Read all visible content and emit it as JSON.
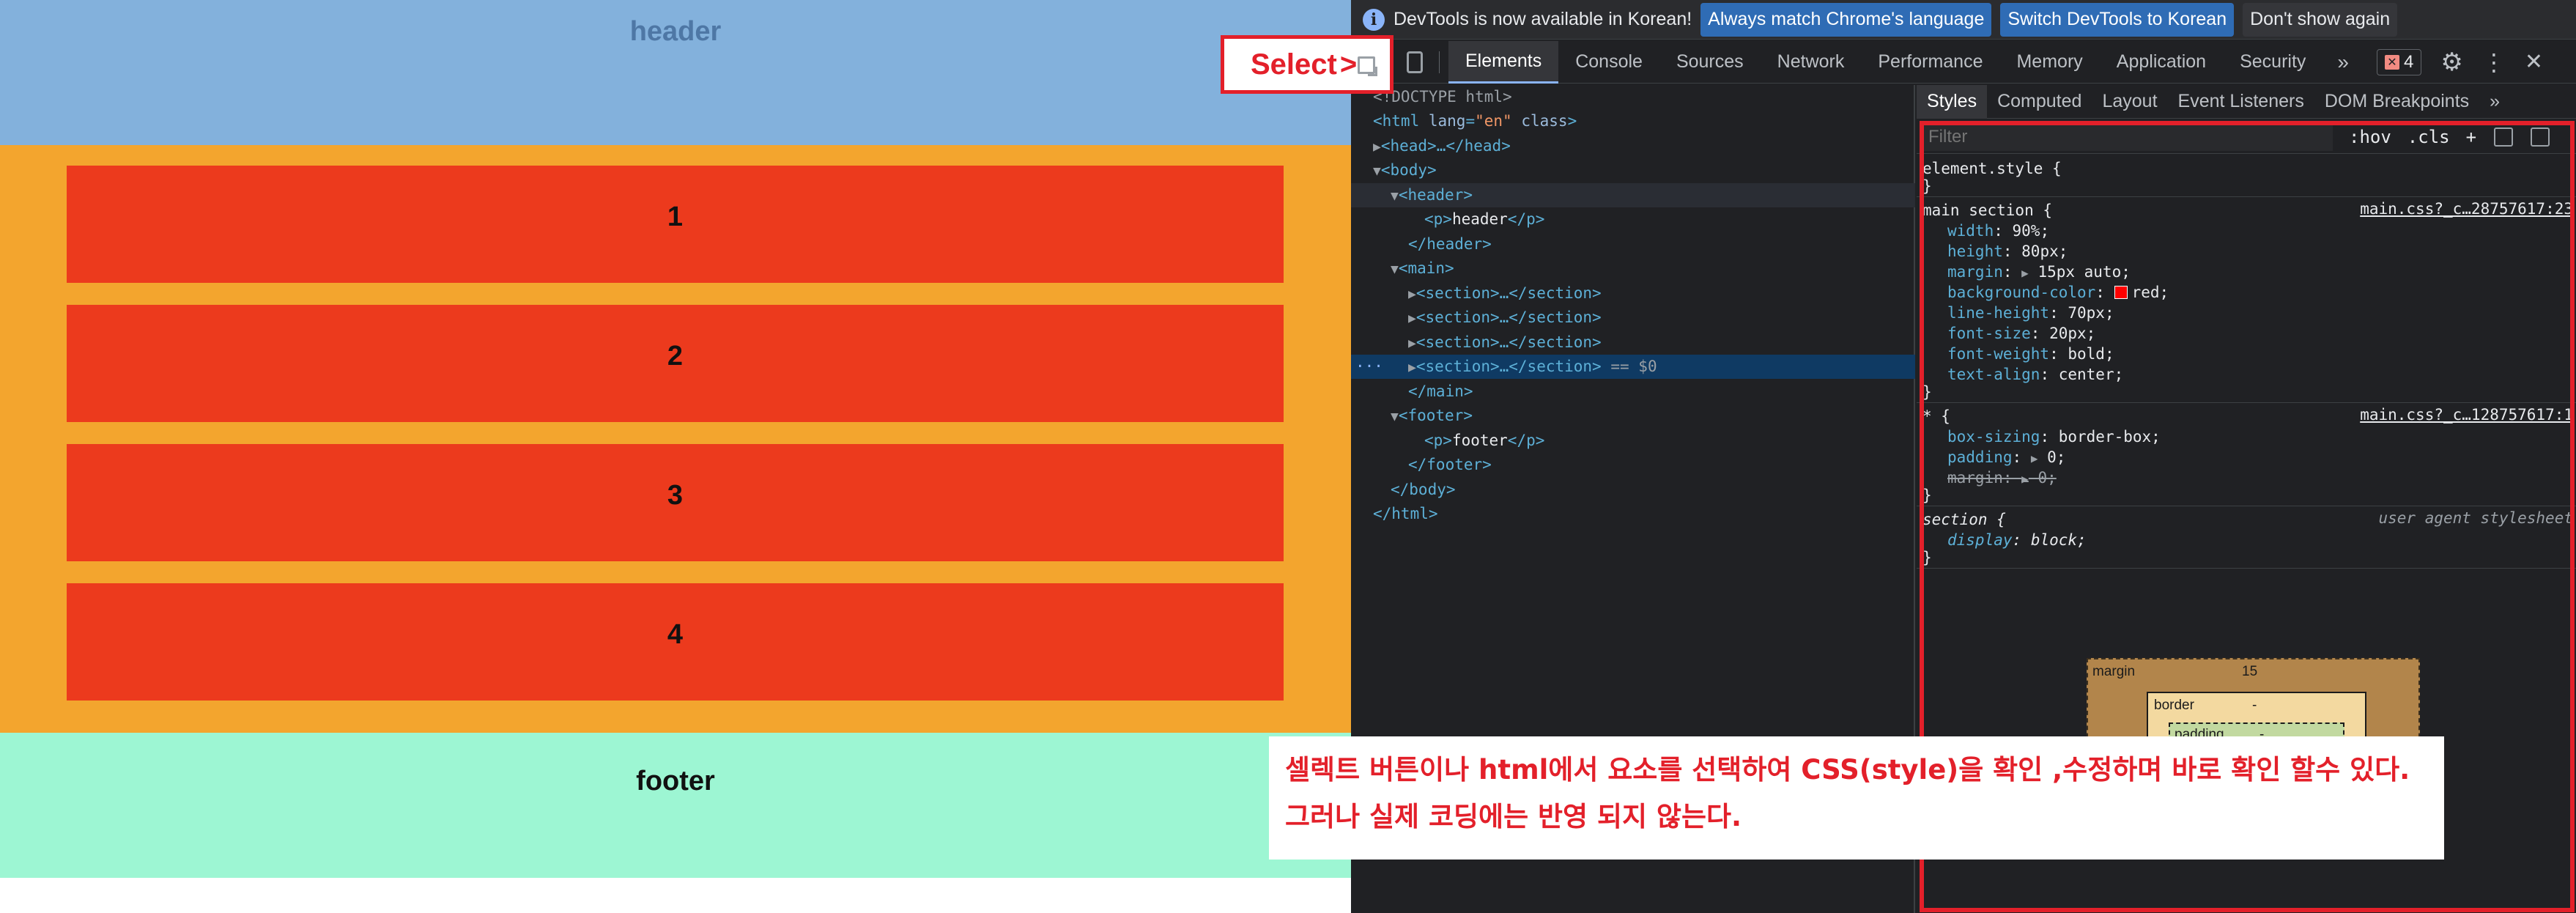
{
  "preview": {
    "header_text": "header",
    "sections": [
      "1",
      "2",
      "3",
      "4"
    ],
    "footer_text": "footer",
    "colors": {
      "header": "#83b1dc",
      "main": "#f3a52e",
      "section": "#ec3a1d",
      "footer": "#9df6d3"
    }
  },
  "callout": {
    "label": "Select",
    "arrow": ">"
  },
  "infobar": {
    "message": "DevTools is now available in Korean!",
    "btn_match": "Always match Chrome's language",
    "btn_switch": "Switch DevTools to Korean",
    "btn_dismiss": "Don't show again"
  },
  "tabs": [
    "Elements",
    "Console",
    "Sources",
    "Network",
    "Performance",
    "Memory",
    "Application",
    "Security"
  ],
  "tabs_more": "»",
  "error_count": "4",
  "dom": {
    "doctype": "<!DOCTYPE html>",
    "html_open_tag": "<html",
    "html_attr_lang": "lang",
    "html_attr_lang_val": "\"en\"",
    "html_attr_class": "class",
    "head": "<head>…</head>",
    "body_open": "<body>",
    "header_open": "<header>",
    "p_header_open": "<p>",
    "p_header_text": "header",
    "p_header_close": "</p>",
    "header_close": "</header>",
    "main_open": "<main>",
    "section_collapsed": "<section>…</section>",
    "selected_suffix": "== $0",
    "main_close": "</main>",
    "footer_open": "<footer>",
    "p_footer_open": "<p>",
    "p_footer_text": "footer",
    "p_footer_close": "</p>",
    "footer_close": "</footer>",
    "body_close": "</body>",
    "html_close": "</html>",
    "dots": "···"
  },
  "styles": {
    "subtabs": [
      "Styles",
      "Computed",
      "Layout",
      "Event Listeners",
      "DOM Breakpoints"
    ],
    "subtabs_more": "»",
    "filter_placeholder": "Filter",
    "hov": ":hov",
    "cls": ".cls",
    "plus": "+",
    "rules": {
      "element_style": "element.style {",
      "main_section": {
        "selector": "main section {",
        "source": "main.css?_c…28757617:23",
        "decls": [
          {
            "name": "width",
            "value": "90%;"
          },
          {
            "name": "height",
            "value": "80px;"
          },
          {
            "name": "margin",
            "value": "15px auto;"
          },
          {
            "name": "background-color",
            "value": "red;"
          },
          {
            "name": "line-height",
            "value": "70px;"
          },
          {
            "name": "font-size",
            "value": "20px;"
          },
          {
            "name": "font-weight",
            "value": "bold;"
          },
          {
            "name": "text-align",
            "value": "center;"
          }
        ]
      },
      "universal": {
        "selector": "* {",
        "source": "main.css?_c…128757617:1",
        "decls": [
          {
            "name": "box-sizing",
            "value": "border-box;"
          },
          {
            "name": "padding",
            "value": "0;"
          },
          {
            "name": "margin",
            "value": "0;"
          }
        ]
      },
      "section_ua": {
        "selector": "section {",
        "source": "user agent stylesheet",
        "decls": [
          {
            "name": "display",
            "value": "block;"
          }
        ]
      }
    },
    "boxmodel": {
      "margin_label": "margin",
      "margin_value": "15",
      "border_label": "border",
      "border_value": "-",
      "padding_label": "padding",
      "padding_value": "-"
    }
  },
  "note": {
    "line1": "셀렉트 버튼이나 html에서 요소를 선택하여 CSS(style)을 확인 ,수정하며 바로 확인 할수 있다.",
    "line2": "그러나 실제 코딩에는 반영 되지 않는다."
  }
}
